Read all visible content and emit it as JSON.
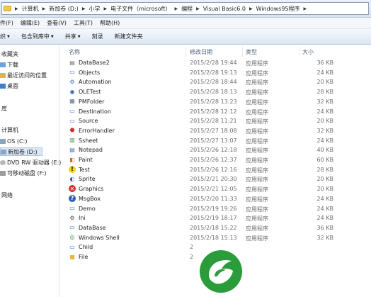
{
  "address": {
    "crumbs": [
      "计算机",
      "新加卷 (D:)",
      "小学",
      "电子文件（microsoft）",
      "编程",
      "Visual Basic6.0",
      "Windows95程序"
    ]
  },
  "menu": [
    "件(F)",
    "编辑(E)",
    "查看(V)",
    "工具(T)",
    "帮助(H)"
  ],
  "toolbar": {
    "organize_label": "织",
    "include_label": "包含到库中",
    "share_label": "共享",
    "burn_label": "刻录",
    "newfolder_label": "新建文件夹"
  },
  "nav": {
    "favorites": "收藏夹",
    "downloads": "下载",
    "recent": "最近访问的位置",
    "desktop": "桌面",
    "libraries": "库",
    "computer": "计算机",
    "os": "OS (C:)",
    "newvol": "新加卷 (D:)",
    "dvd": "DVD RW 驱动器 (E:)",
    "removable": "可移动磁盘 (F:)",
    "network": "网络"
  },
  "columns": {
    "name": "名称",
    "date": "修改日期",
    "type": "类型",
    "size": "大小"
  },
  "files": [
    {
      "name": "DataBase2",
      "date": "2015/2/28 19:44",
      "type": "应用程序",
      "size": "36 KB",
      "icon": "database-icon"
    },
    {
      "name": "Objects",
      "date": "2015/2/28 19:13",
      "type": "应用程序",
      "size": "24 KB",
      "icon": "app-icon"
    },
    {
      "name": "Automation",
      "date": "2015/2/28 18:44",
      "type": "应用程序",
      "size": "20 KB",
      "icon": "gear-icon"
    },
    {
      "name": "OLETest",
      "date": "2015/2/28 18:13",
      "type": "应用程序",
      "size": "28 KB",
      "icon": "ole-icon"
    },
    {
      "name": "PMFolder",
      "date": "2015/2/28 13:23",
      "type": "应用程序",
      "size": "32 KB",
      "icon": "folder-app-icon"
    },
    {
      "name": "Destination",
      "date": "2015/2/28 12:12",
      "type": "应用程序",
      "size": "24 KB",
      "icon": "app-icon"
    },
    {
      "name": "Source",
      "date": "2015/2/28 11:21",
      "type": "应用程序",
      "size": "20 KB",
      "icon": "app-icon"
    },
    {
      "name": "ErrorHandler",
      "date": "2015/2/27 18:08",
      "type": "应用程序",
      "size": "32 KB",
      "icon": "stop-icon"
    },
    {
      "name": "Ssheet",
      "date": "2015/2/27 13:07",
      "type": "应用程序",
      "size": "24 KB",
      "icon": "sheet-icon"
    },
    {
      "name": "Notepad",
      "date": "2015/2/26 12:18",
      "type": "应用程序",
      "size": "40 KB",
      "icon": "notepad-icon"
    },
    {
      "name": "Paint",
      "date": "2015/2/26 12:37",
      "type": "应用程序",
      "size": "60 KB",
      "icon": "paint-icon"
    },
    {
      "name": "Test",
      "date": "2015/2/26 12:16",
      "type": "应用程序",
      "size": "28 KB",
      "icon": "warning-icon"
    },
    {
      "name": "Sprite",
      "date": "2015/2/21 20:30",
      "type": "应用程序",
      "size": "20 KB",
      "icon": "sprite-icon"
    },
    {
      "name": "Graphics",
      "date": "2015/2/21 12:05",
      "type": "应用程序",
      "size": "20 KB",
      "icon": "error-icon"
    },
    {
      "name": "MsgBox",
      "date": "2015/2/20 11:33",
      "type": "应用程序",
      "size": "24 KB",
      "icon": "info-icon"
    },
    {
      "name": "Demo",
      "date": "2015/2/19 19:26",
      "type": "应用程序",
      "size": "24 KB",
      "icon": "app-icon"
    },
    {
      "name": "Ini",
      "date": "2015/2/19 18:17",
      "type": "应用程序",
      "size": "24 KB",
      "icon": "settings-icon"
    },
    {
      "name": "DataBase",
      "date": "2015/2/18 15:22",
      "type": "应用程序",
      "size": "36 KB",
      "icon": "app-icon"
    },
    {
      "name": "Windows Shell",
      "date": "2015/2/18 15:13",
      "type": "应用程序",
      "size": "32 KB",
      "icon": "shell-icon"
    },
    {
      "name": "Child",
      "date": "2",
      "type": "",
      "size": "",
      "icon": "app-icon"
    },
    {
      "name": "File",
      "date": "2",
      "type": "",
      "size": "",
      "icon": "folder-icon"
    }
  ],
  "colors": {
    "selection": "#dbe7f6",
    "logo_green": "#2a9d3a"
  }
}
